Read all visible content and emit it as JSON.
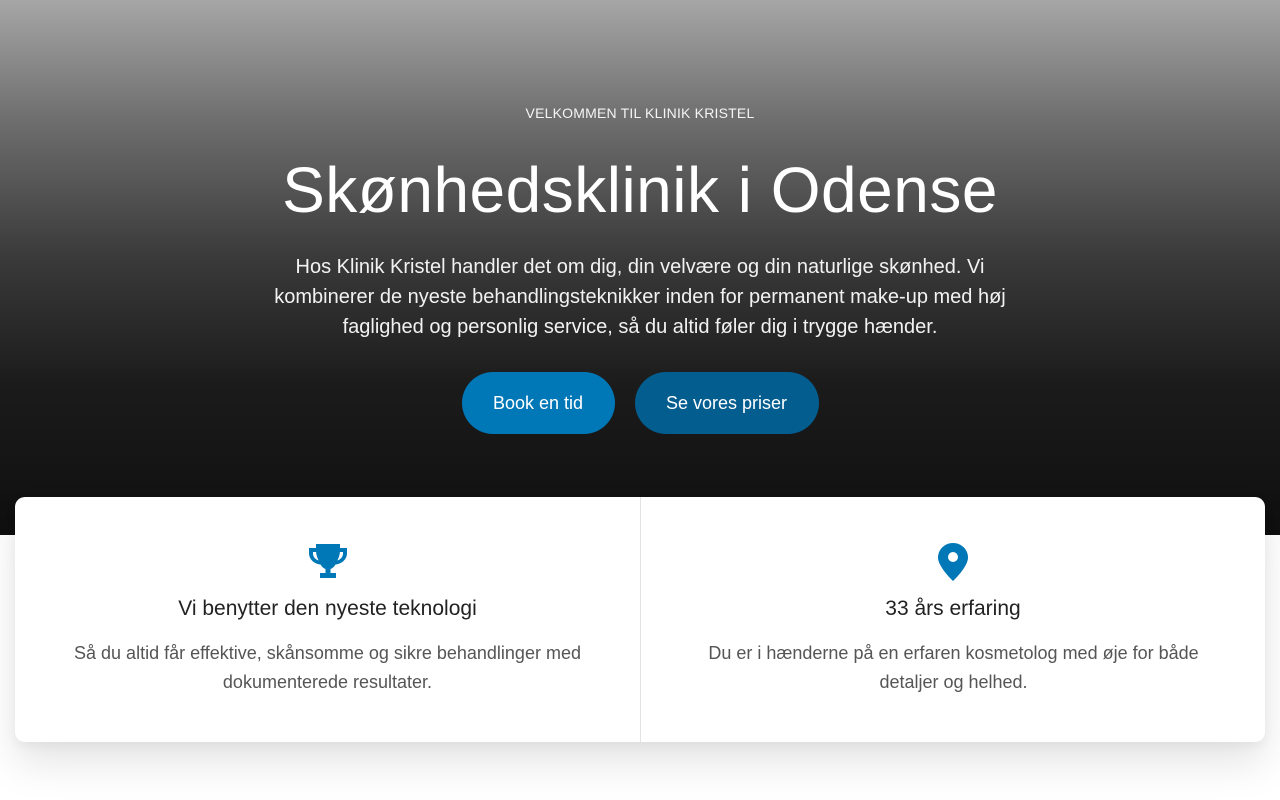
{
  "hero": {
    "eyebrow": "VELKOMMEN TIL KLINIK KRISTEL",
    "title": "Skønhedsklinik i Odense",
    "text": "Hos Klinik Kristel handler det om dig, din velvære og din naturlige skønhed. Vi kombinerer de nyeste behandlingsteknikker inden for permanent make-up med høj faglighed og personlig service, så du altid føler dig i trygge hænder.",
    "buttons": {
      "book_label": "Book en tid",
      "prices_label": "Se vores priser"
    }
  },
  "features": [
    {
      "icon": "trophy-icon",
      "title": "Vi benytter den nyeste teknologi",
      "text": "Så du altid får effektive, skånsomme og sikre behandlinger med dokumenterede resultater."
    },
    {
      "icon": "map-pin-icon",
      "title": "33 års erfaring",
      "text": "Du er i hænderne på en erfaren kosmetolog med øje for både detaljer og helhed."
    }
  ],
  "colors": {
    "accent": "#0077b6",
    "accent_dark": "#035d8f"
  }
}
